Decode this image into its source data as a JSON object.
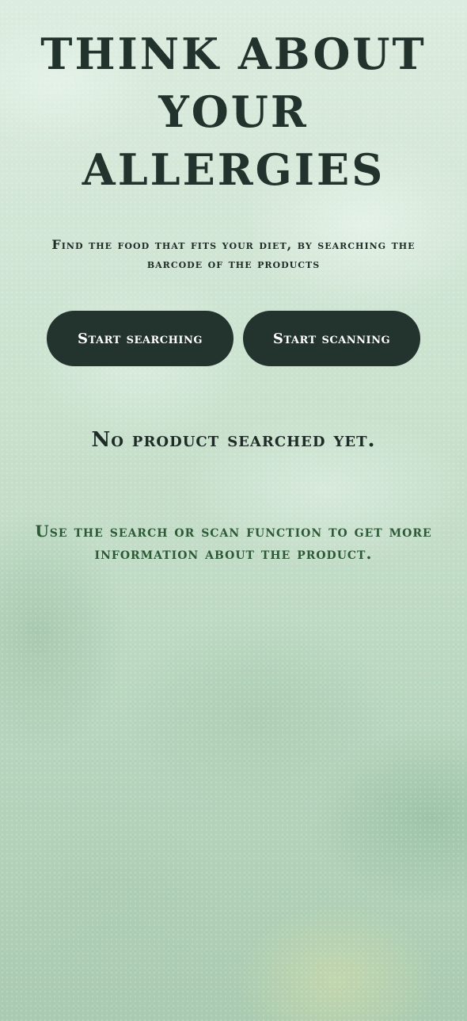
{
  "hero": {
    "title": "THINK ABOUT YOUR ALLERGIES",
    "subtitle": "Find the food that fits your diet, by searching the barcode of the products"
  },
  "actions": {
    "search_label": "Start searching",
    "scan_label": "Start scanning"
  },
  "status": {
    "message": "No product searched yet."
  },
  "hint": {
    "text": "Use the search or scan function to get more information about the product."
  },
  "colors": {
    "button_bg": "#23332e",
    "button_text": "#ffffff",
    "heading": "#21332c",
    "hint_text": "#2c5a35",
    "background": "#c6decb"
  }
}
